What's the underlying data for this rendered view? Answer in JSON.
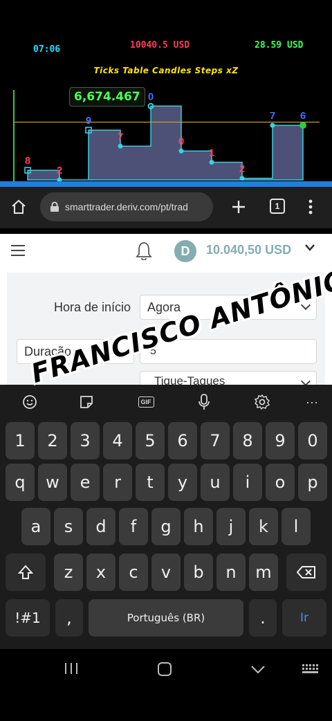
{
  "overlay": {
    "time": "07:06",
    "balance": "10040.5 USD",
    "profit": "28.59 USD",
    "menu": "Ticks Table Candles Steps xZ",
    "tooltip": "6,674.467",
    "colors": {
      "time": "#19e6ff",
      "balance": "#ff3c5a",
      "profit": "#3cff5a",
      "menu": "#ffe600"
    }
  },
  "chart_data": {
    "type": "area",
    "description_of_steps": "last-digit tick step chart",
    "digits": [
      "8",
      "2",
      "9",
      "7",
      "0",
      "0",
      "1",
      "2",
      "7",
      "6"
    ],
    "digit_colors": [
      "#ff3c5a",
      "#ff3c5a",
      "#4a6bff",
      "#ff3c5a",
      "#4a6bff",
      "#ff3c5a",
      "#ff3c5a",
      "#ff3c5a",
      "#4a6bff",
      "#4a6bff"
    ],
    "levels": [
      0.12,
      0.0,
      0.62,
      0.42,
      0.92,
      0.36,
      0.22,
      0.02,
      0.68,
      0.68
    ],
    "reference_level": 0.72,
    "tooltip_value": "6,674.467"
  },
  "browser": {
    "url": "smarttrader.deriv.com/pt/trad",
    "tabs_count": "1"
  },
  "header": {
    "balance": "10.040,50 USD",
    "account_icon_letter": "D"
  },
  "form": {
    "start_label": "Hora de início",
    "start_value": "Agora",
    "duration_label": "Duração",
    "duration_value": "5",
    "unit_value": "Tique-Taques"
  },
  "keyboard": {
    "toolbar": [
      "emoji",
      "sticker",
      "GIF",
      "mic",
      "settings",
      "more"
    ],
    "gif_label": "GIF",
    "more_label": "···",
    "row_numbers": [
      "1",
      "2",
      "3",
      "4",
      "5",
      "6",
      "7",
      "8",
      "9",
      "0"
    ],
    "row1": [
      "q",
      "w",
      "e",
      "r",
      "t",
      "y",
      "u",
      "i",
      "o",
      "p"
    ],
    "row2": [
      "a",
      "s",
      "d",
      "f",
      "g",
      "h",
      "j",
      "k",
      "l"
    ],
    "row3": [
      "z",
      "x",
      "c",
      "v",
      "b",
      "n",
      "m"
    ],
    "symbols_label": "!#1",
    "comma_label": ",",
    "space_label": "Português (BR)",
    "period_label": ".",
    "go_label": "Ir",
    "go_color": "#4a90e2"
  },
  "watermark": "FRANCISCO ANTÔNIO"
}
